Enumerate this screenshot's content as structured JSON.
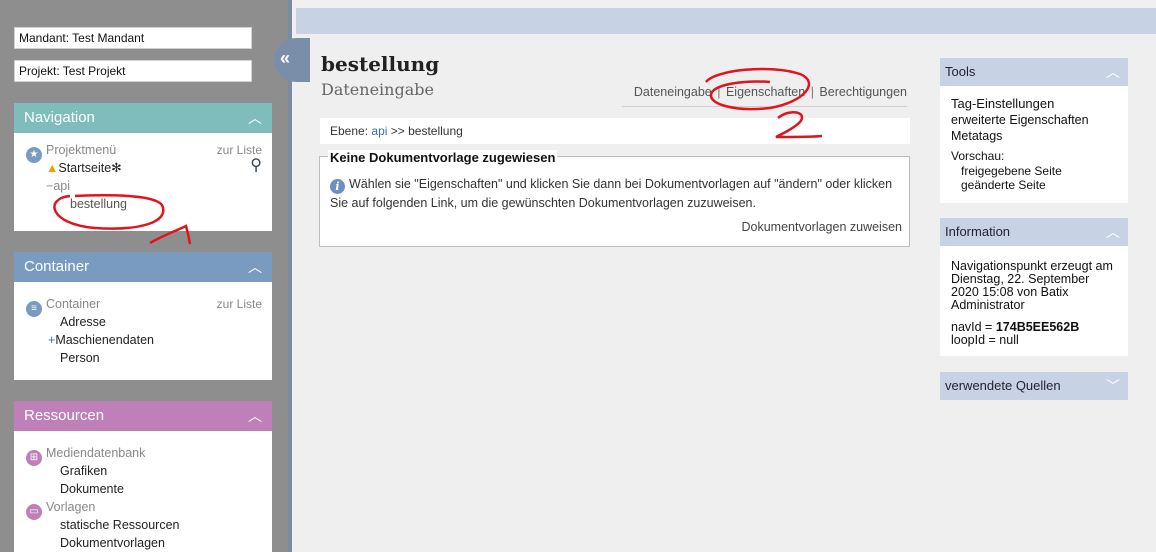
{
  "sidebar": {
    "mandant": "Mandant: Test Mandant",
    "projekt": "Projekt: Test Projekt",
    "collapse_glyph": "«",
    "navigation": {
      "title": "Navigation",
      "root_label": "Projektmenü",
      "root_link": "zur Liste",
      "items": {
        "startseite": "Startseite",
        "api": "api",
        "bestellung": "bestellung"
      }
    },
    "container": {
      "title": "Container",
      "root_label": "Container",
      "root_link": "zur Liste",
      "items": {
        "adresse": "Adresse",
        "maschinendaten": "Maschienendaten",
        "person": "Person"
      }
    },
    "ressourcen": {
      "title": "Ressourcen",
      "mediendatenbank": "Mediendatenbank",
      "grafiken": "Grafiken",
      "dokumente": "Dokumente",
      "vorlagen": "Vorlagen",
      "statische": "statische Ressourcen",
      "dokumentvorlagen": "Dokumentvorlagen"
    }
  },
  "main": {
    "title": "bestellung",
    "subtitle": "Dateneingabe",
    "tabs": {
      "dateneingabe": "Dateneingabe",
      "eigenschaften": "Eigenschaften",
      "berechtigungen": "Berechtigungen",
      "separator": "|"
    },
    "breadcrumb": {
      "prefix": "Ebene:",
      "api": "api",
      "sep": ">>",
      "current": "bestellung"
    },
    "notice": {
      "title": "Keine Dokumentvorlage zugewiesen",
      "text": "Wählen sie \"Eigenschaften\" und klicken Sie dann bei Dokumentvorlagen auf \"ändern\" oder klicken Sie auf folgenden Link, um die gewünschten Dokumentvorlagen zuzuweisen.",
      "link": "Dokumentvorlagen zuweisen"
    }
  },
  "right": {
    "tools": {
      "title": "Tools",
      "tag_einstellungen": "Tag-Einstellungen",
      "erweiterte": "erweiterte Eigenschaften",
      "metatags": "Metatags",
      "vorschau": "Vorschau:",
      "freigegebene": "freigegebene Seite",
      "geaenderte": "geänderte Seite"
    },
    "information": {
      "title": "Information",
      "text": "Navigationspunkt erzeugt am Dienstag, 22. September 2020 15:08 von Batix Administrator",
      "navid_label": "navId =",
      "navid_value": "174B5EE562B",
      "loopid": "loopId = null"
    },
    "quellen": {
      "title": "verwendete Quellen"
    }
  },
  "annotations": {
    "one": "1",
    "two": "2"
  },
  "colors": {
    "navigation_head": "#7fbcbc",
    "container_head": "#7a9bc0",
    "ressourcen_head": "#bf7fb8",
    "right_head": "#c7d3e4",
    "annotation_red": "#e0141c"
  }
}
